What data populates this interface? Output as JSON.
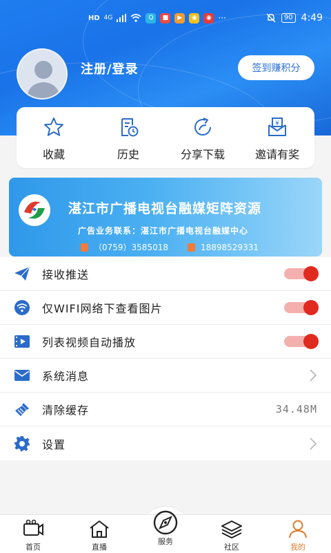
{
  "status_bar": {
    "left_indicators": [
      "HD",
      "4G"
    ],
    "time": "4:49",
    "battery": "90"
  },
  "profile": {
    "login_label": "注册/登录",
    "signin_button": "签到赚积分"
  },
  "quick_actions": [
    {
      "label": "收藏",
      "icon": "star-icon"
    },
    {
      "label": "历史",
      "icon": "history-icon"
    },
    {
      "label": "分享下载",
      "icon": "share-icon"
    },
    {
      "label": "邀请有奖",
      "icon": "invite-icon"
    }
  ],
  "banner": {
    "title": "湛江市广播电视台融媒矩阵资源",
    "contact": "广告业务联系：湛江市广播电视台融媒中心",
    "phone1": "（0759）3585018",
    "phone2": "18898529331"
  },
  "settings": [
    {
      "label": "接收推送",
      "icon": "send-icon",
      "right": "toggle",
      "on": true
    },
    {
      "label": "仅WIFI网络下查看图片",
      "icon": "wifi-icon",
      "right": "toggle",
      "on": true
    },
    {
      "label": "列表视频自动播放",
      "icon": "video-icon",
      "right": "toggle",
      "on": true
    },
    {
      "label": "系统消息",
      "icon": "mail-icon",
      "right": "chevron"
    },
    {
      "label": "清除缓存",
      "icon": "broom-icon",
      "right": "value",
      "value": "34.48M"
    },
    {
      "label": "设置",
      "icon": "gear-icon",
      "right": "chevron"
    }
  ],
  "tabs": [
    {
      "label": "首页",
      "icon": "video-camera-icon"
    },
    {
      "label": "直播",
      "icon": "house-icon"
    },
    {
      "label": "服务",
      "icon": "compass-icon"
    },
    {
      "label": "社区",
      "icon": "layers-icon"
    },
    {
      "label": "我的",
      "icon": "person-icon"
    }
  ],
  "colors": {
    "header_blue": "#1a73e8",
    "icon_blue": "#2b6bc9",
    "toggle_on": "#e02a1f",
    "active_tab": "#e07b2c"
  }
}
